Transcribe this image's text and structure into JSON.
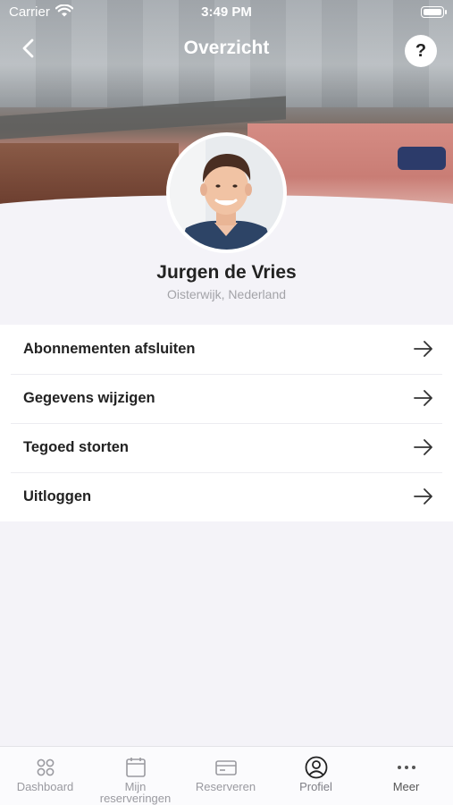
{
  "status_bar": {
    "carrier": "Carrier",
    "time": "3:49 PM"
  },
  "nav": {
    "title": "Overzicht",
    "help_label": "?"
  },
  "profile": {
    "name": "Jurgen de Vries",
    "location": "Oisterwijk, Nederland"
  },
  "menu": {
    "items": [
      {
        "label": "Abonnementen afsluiten"
      },
      {
        "label": "Gegevens wijzigen"
      },
      {
        "label": "Tegoed storten"
      },
      {
        "label": "Uitloggen"
      }
    ]
  },
  "tabbar": {
    "tabs": [
      {
        "label": "Dashboard",
        "icon": "dashboard-icon"
      },
      {
        "label": "Mijn\nreserveringen",
        "icon": "calendar-icon"
      },
      {
        "label": "Reserveren",
        "icon": "card-icon"
      },
      {
        "label": "Profiel",
        "icon": "profile-icon",
        "active": true
      },
      {
        "label": "Meer",
        "icon": "more-icon"
      }
    ]
  },
  "colors": {
    "background": "#f4f3f8",
    "text_primary": "#222222",
    "text_muted": "#a3a3a8"
  }
}
